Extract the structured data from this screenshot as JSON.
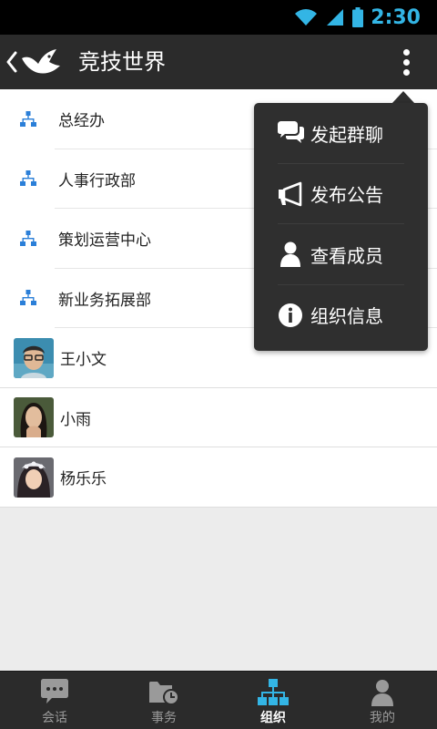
{
  "status_bar": {
    "time": "2:30"
  },
  "header": {
    "title": "竞技世界"
  },
  "departments": [
    {
      "label": "总经办"
    },
    {
      "label": "人事行政部"
    },
    {
      "label": "策划运营中心"
    },
    {
      "label": "新业务拓展部"
    }
  ],
  "members": [
    {
      "name": "王小文"
    },
    {
      "name": "小雨"
    },
    {
      "name": "杨乐乐"
    }
  ],
  "menu": {
    "items": [
      {
        "label": "发起群聊",
        "icon": "chat-bubbles-icon"
      },
      {
        "label": "发布公告",
        "icon": "megaphone-icon"
      },
      {
        "label": "查看成员",
        "icon": "person-icon"
      },
      {
        "label": "组织信息",
        "icon": "info-icon"
      }
    ]
  },
  "tabs": [
    {
      "label": "会话",
      "icon": "chat-icon",
      "active": false
    },
    {
      "label": "事务",
      "icon": "folder-clock-icon",
      "active": false
    },
    {
      "label": "组织",
      "icon": "org-chart-icon",
      "active": true
    },
    {
      "label": "我的",
      "icon": "person-icon",
      "active": false
    }
  ],
  "colors": {
    "accent": "#33b5e5",
    "dept_icon": "#2b7fd8",
    "bar_background": "#2b2b2b",
    "popup_background": "#2f2f2f"
  }
}
